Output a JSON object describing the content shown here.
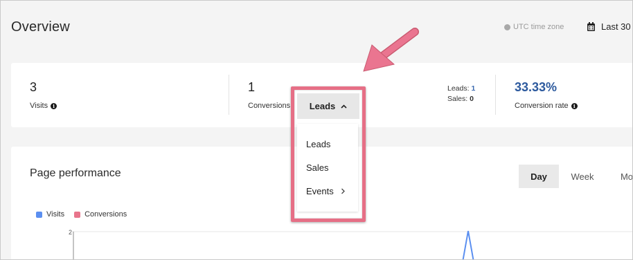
{
  "header": {
    "title": "Overview",
    "timezone": "UTC time zone",
    "date_range": "Last 30"
  },
  "stats": {
    "visits": {
      "value": "3",
      "label": "Visits"
    },
    "conversions": {
      "value": "1",
      "label": "Conversions"
    },
    "breakdown": {
      "leads_label": "Leads:",
      "leads_value": "1",
      "sales_label": "Sales:",
      "sales_value": "0"
    },
    "rate": {
      "value": "33.33%",
      "label": "Conversion rate"
    }
  },
  "conversion_dropdown": {
    "selected": "Leads",
    "options": [
      "Leads",
      "Sales",
      "Events"
    ]
  },
  "performance": {
    "title": "Page performance",
    "periods": [
      "Day",
      "Week",
      "Mo"
    ],
    "active_period": "Day",
    "legend": [
      {
        "name": "Visits",
        "color": "#5b8ff0"
      },
      {
        "name": "Conversions",
        "color": "#e8758c"
      }
    ]
  },
  "chart_data": {
    "type": "line",
    "y_tick_labels": [
      "2"
    ],
    "series": [
      {
        "name": "Visits",
        "color": "#5b8ff0"
      },
      {
        "name": "Conversions",
        "color": "#e8758c"
      }
    ]
  },
  "colors": {
    "highlight": "#e66f86",
    "accent_blue": "#2d5a9e",
    "visits": "#5b8ff0",
    "conversions": "#e8758c"
  }
}
